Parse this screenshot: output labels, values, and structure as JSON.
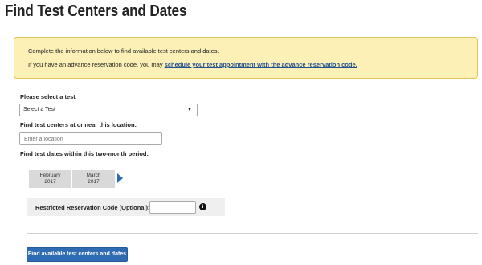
{
  "page": {
    "title": "Find Test Centers and Dates"
  },
  "notice": {
    "line1": "Complete the information below to find available test centers and dates.",
    "line2_prefix": "If you have an advance reservation code, you may ",
    "line2_link": "schedule your test appointment with the advance reservation code."
  },
  "test_select": {
    "label": "Please select a test",
    "selected": "Select a Test",
    "caret": "▼"
  },
  "location": {
    "label": "Find test centers at or near this location:",
    "placeholder": "Enter a location"
  },
  "dates": {
    "label": "Find test dates within this two-month period:",
    "months": [
      {
        "month": "February",
        "year": "2017"
      },
      {
        "month": "March",
        "year": "2017"
      }
    ]
  },
  "reservation": {
    "label": "Restricted Reservation Code (Optional):",
    "info_glyph": "i"
  },
  "submit": {
    "label": "Find available test centers and dates"
  },
  "colors": {
    "accent": "#2e6bb3",
    "notice_bg": "#fcf0b6",
    "notice_border": "#e0c45a",
    "link": "#1f4f8f"
  }
}
